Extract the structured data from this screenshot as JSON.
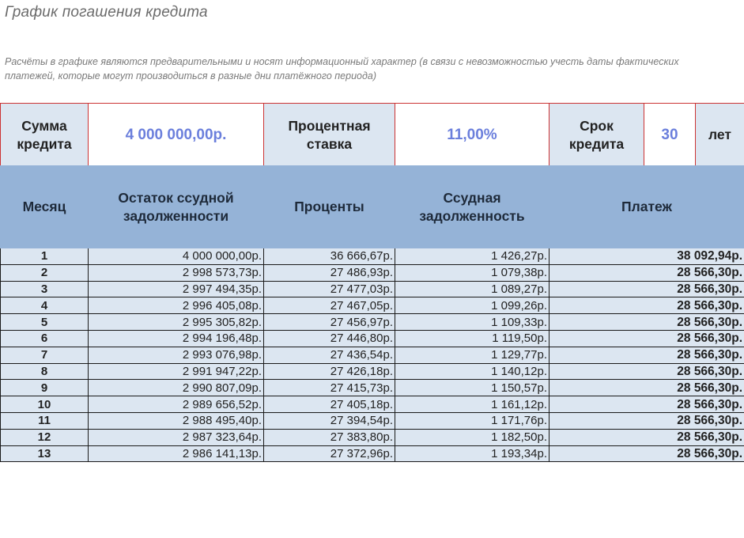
{
  "title": "График погашения кредита",
  "disclaimer": "Расчёты в графике являются предварительными и носят информационный характер (в связи с невозможностью учесть даты фактических платежей, которые могут производиться в разные дни платёжного периода)",
  "params": {
    "amount_label_1": "Сумма",
    "amount_label_2": "кредита",
    "amount_value": "4 000 000,00р.",
    "rate_label_1": "Процентная",
    "rate_label_2": "ставка",
    "rate_value": "11,00%",
    "term_label_1": "Срок",
    "term_label_2": "кредита",
    "term_value": "30",
    "term_unit": "лет"
  },
  "columns": {
    "month": "Месяц",
    "balance_1": "Остаток ссудной",
    "balance_2": "задолженности",
    "interest": "Проценты",
    "principal_1": "Ссудная",
    "principal_2": "задолженность",
    "payment": "Платеж"
  },
  "rows": [
    {
      "month": "1",
      "balance": "4 000 000,00р.",
      "interest": "36 666,67р.",
      "principal": "1 426,27р.",
      "payment": "38 092,94р."
    },
    {
      "month": "2",
      "balance": "2 998 573,73р.",
      "interest": "27 486,93р.",
      "principal": "1 079,38р.",
      "payment": "28 566,30р."
    },
    {
      "month": "3",
      "balance": "2 997 494,35р.",
      "interest": "27 477,03р.",
      "principal": "1 089,27р.",
      "payment": "28 566,30р."
    },
    {
      "month": "4",
      "balance": "2 996 405,08р.",
      "interest": "27 467,05р.",
      "principal": "1 099,26р.",
      "payment": "28 566,30р."
    },
    {
      "month": "5",
      "balance": "2 995 305,82р.",
      "interest": "27 456,97р.",
      "principal": "1 109,33р.",
      "payment": "28 566,30р."
    },
    {
      "month": "6",
      "balance": "2 994 196,48р.",
      "interest": "27 446,80р.",
      "principal": "1 119,50р.",
      "payment": "28 566,30р."
    },
    {
      "month": "7",
      "balance": "2 993 076,98р.",
      "interest": "27 436,54р.",
      "principal": "1 129,77р.",
      "payment": "28 566,30р."
    },
    {
      "month": "8",
      "balance": "2 991 947,22р.",
      "interest": "27 426,18р.",
      "principal": "1 140,12р.",
      "payment": "28 566,30р."
    },
    {
      "month": "9",
      "balance": "2 990 807,09р.",
      "interest": "27 415,73р.",
      "principal": "1 150,57р.",
      "payment": "28 566,30р."
    },
    {
      "month": "10",
      "balance": "2 989 656,52р.",
      "interest": "27 405,18р.",
      "principal": "1 161,12р.",
      "payment": "28 566,30р."
    },
    {
      "month": "11",
      "balance": "2 988 495,40р.",
      "interest": "27 394,54р.",
      "principal": "1 171,76р.",
      "payment": "28 566,30р."
    },
    {
      "month": "12",
      "balance": "2 987 323,64р.",
      "interest": "27 383,80р.",
      "principal": "1 182,50р.",
      "payment": "28 566,30р."
    },
    {
      "month": "13",
      "balance": "2 986 141,13р.",
      "interest": "27 372,96р.",
      "principal": "1 193,34р.",
      "payment": "28 566,30р."
    }
  ]
}
